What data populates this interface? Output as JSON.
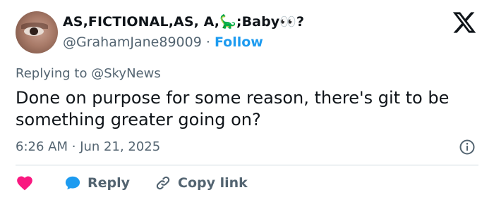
{
  "author": {
    "display_name": "AS,FICTIONAL,AS, A,",
    "emoji_1": "🦕",
    "name_mid": ";Baby",
    "emoji_2": "👀",
    "name_end": "?",
    "handle": "@GrahamJane89009",
    "separator": "·",
    "follow_label": "Follow"
  },
  "tweet": {
    "replying_to_prefix": "Replying to",
    "replying_to_handle": "@SkyNews",
    "text": "Done on purpose for some reason, there's git to be something greater going on?",
    "time": "6:26 AM",
    "separator": "·",
    "date": "Jun 21, 2025"
  },
  "actions": {
    "reply_label": "Reply",
    "copy_link_label": "Copy link"
  },
  "icons": {
    "logo": "x-logo-icon",
    "info": "info-icon",
    "like": "heart-icon",
    "reply": "reply-bubble-icon",
    "copy": "link-icon"
  },
  "colors": {
    "follow": "#1d9bf0",
    "like": "#f91880",
    "reply": "#1d9bf0",
    "secondary_text": "#536471"
  }
}
